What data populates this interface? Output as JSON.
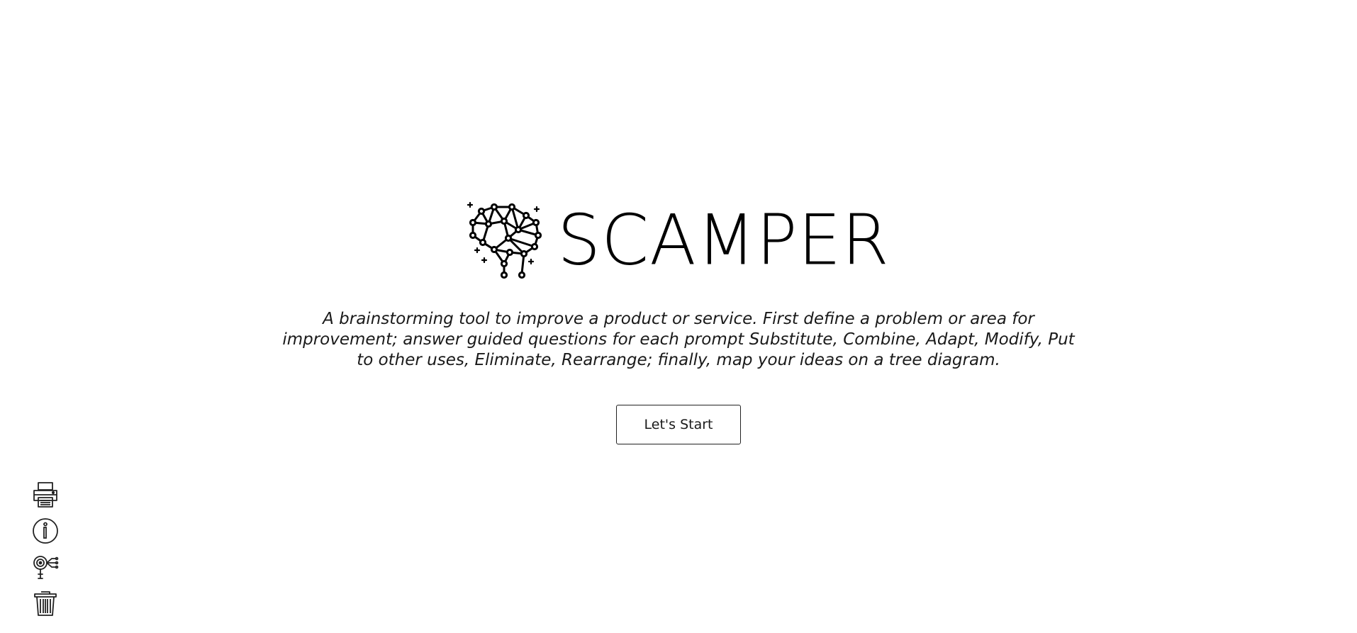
{
  "app": {
    "title": "SCAMPER",
    "logo_icon": "brain-network-icon"
  },
  "intro": {
    "description": "A brainstorming tool to improve a product or service. First define a problem or area for improvement; answer guided questions for each prompt Substitute, Combine, Adapt, Modify, Put to other uses, Eliminate, Rearrange; finally, map your ideas on a tree diagram.",
    "start_label": "Let's Start"
  },
  "toolbar": {
    "items": [
      {
        "icon": "printer-icon"
      },
      {
        "icon": "info-icon"
      },
      {
        "icon": "idea-search-icon"
      },
      {
        "icon": "trash-icon"
      }
    ]
  },
  "colors": {
    "background": "#ffffff",
    "text": "#111111",
    "border": "#222222"
  }
}
